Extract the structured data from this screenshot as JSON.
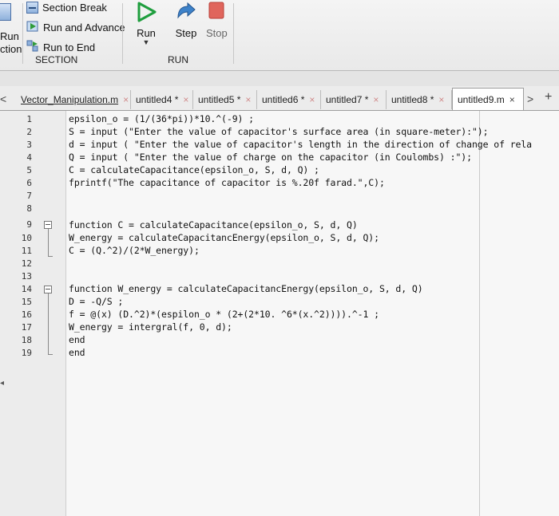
{
  "toolstrip": {
    "section_group": {
      "section_break": "Section Break",
      "run_and_advance": "Run and Advance",
      "run_to_end": "Run to End",
      "label": "SECTION",
      "cut_run": "Run",
      "cut_section": "ction"
    },
    "run_group": {
      "run": "Run",
      "step": "Step",
      "stop": "Stop",
      "label": "RUN"
    }
  },
  "tabs": [
    {
      "label": "Vector_Manipulation.m",
      "close": "×",
      "active": false
    },
    {
      "label": "untitled4 *",
      "close": "×",
      "active": false
    },
    {
      "label": "untitled5 *",
      "close": "×",
      "active": false
    },
    {
      "label": "untitled6 *",
      "close": "×",
      "active": false
    },
    {
      "label": "untitled7 *",
      "close": "×",
      "active": false
    },
    {
      "label": "untitled8 *",
      "close": "×",
      "active": false
    },
    {
      "label": "untitled9.m",
      "close": "×",
      "active": true
    }
  ],
  "tab_controls": {
    "scroll_left": "<",
    "scroll_right": ">",
    "new_tab": "+"
  },
  "editor": {
    "lines": [
      {
        "num": "1",
        "code": "epsilon_o = (1/(36*pi))*10.^(-9) ;"
      },
      {
        "num": "2",
        "code": "S = input (\"Enter the value of capacitor's surface area (in square-meter):\");"
      },
      {
        "num": "3",
        "code": "d = input ( \"Enter the value of capacitor's length in the direction of change of rela"
      },
      {
        "num": "4",
        "code": "Q = input ( \"Enter the value of charge on the capacitor (in Coulombs) :\");"
      },
      {
        "num": "5",
        "code": "C = calculateCapacitance(epsilon_o, S, d, Q) ;"
      },
      {
        "num": "6",
        "code": "fprintf(\"The capacitance of capacitor is %.20f farad.\",C);"
      },
      {
        "num": "7",
        "code": ""
      },
      {
        "num": "8",
        "code": ""
      },
      {
        "num": "9",
        "code": "function C = calculateCapacitance(epsilon_o, S, d, Q)"
      },
      {
        "num": "10",
        "code": "W_energy = calculateCapacitancEnergy(epsilon_o, S, d, Q);"
      },
      {
        "num": "11",
        "code": "C = (Q.^2)/(2*W_energy);"
      },
      {
        "num": "12",
        "code": ""
      },
      {
        "num": "13",
        "code": ""
      },
      {
        "num": "14",
        "code": "function W_energy = calculateCapacitancEnergy(epsilon_o, S, d, Q)"
      },
      {
        "num": "15",
        "code": "D = -Q/S ;"
      },
      {
        "num": "16",
        "code": "f = @(x) (D.^2)*(espilon_o * (2+(2*10. ^6*(x.^2)))).^-1 ;"
      },
      {
        "num": "17",
        "code": "W_energy = intergral(f, 0, d);"
      },
      {
        "num": "18",
        "code": "end"
      },
      {
        "num": "19",
        "code": "end"
      }
    ]
  }
}
